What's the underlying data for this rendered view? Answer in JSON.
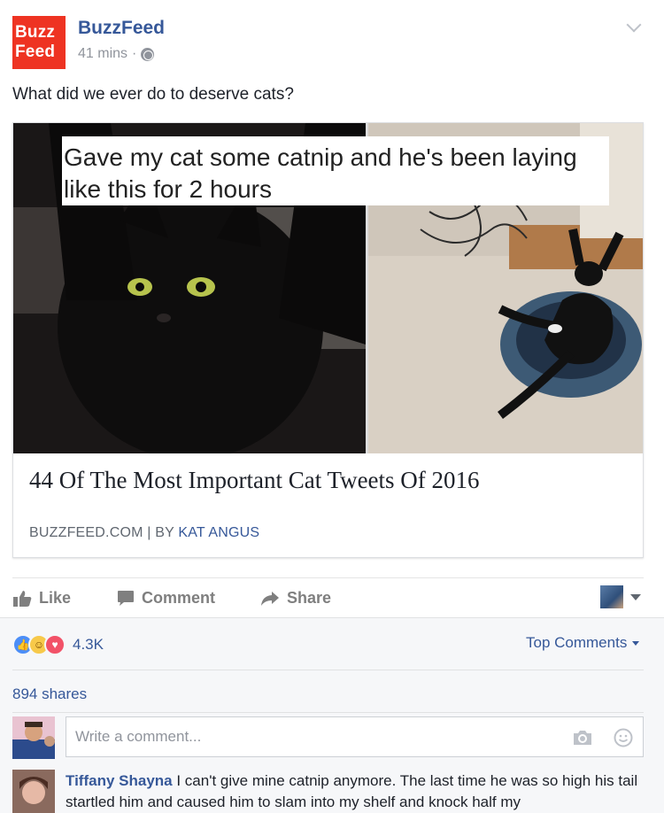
{
  "header": {
    "logo_line1": "Buzz",
    "logo_line2": "Feed",
    "author": "BuzzFeed",
    "time": "41 mins",
    "separator": "·"
  },
  "post": {
    "text": "What did we ever do to deserve cats?"
  },
  "link_card": {
    "image_caption": "Gave my cat some catnip and he's been laying like this for 2 hours",
    "title": "44 Of The Most Important Cat Tweets Of 2016",
    "domain": "BUZZFEED.COM",
    "byline_sep": " | BY ",
    "byline_author": "KAT ANGUS"
  },
  "actions": {
    "like": "Like",
    "comment": "Comment",
    "share": "Share"
  },
  "engagement": {
    "reaction_count": "4.3K",
    "sort_label": "Top Comments",
    "shares": "894 shares"
  },
  "composer": {
    "placeholder": "Write a comment..."
  },
  "comments": [
    {
      "name": "Tiffany Shayna",
      "text": "I can't give mine catnip anymore. The last time he was so high his tail startled him and caused him to slam into my shelf and knock half my"
    }
  ],
  "colors": {
    "brand_red": "#ee3322",
    "link_blue": "#365899",
    "muted_gray": "#90949c"
  },
  "icons": [
    "globe-icon",
    "chevron-down-icon",
    "like-icon",
    "comment-icon",
    "share-icon",
    "camera-icon",
    "emoji-icon"
  ]
}
